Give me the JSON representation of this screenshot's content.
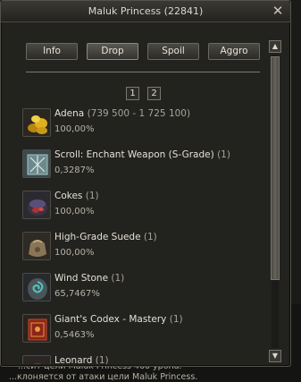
{
  "window": {
    "title": "Maluk Princess (22841)"
  },
  "tabs": [
    {
      "label": "Info"
    },
    {
      "label": "Drop"
    },
    {
      "label": "Spoil"
    },
    {
      "label": "Aggro"
    }
  ],
  "pages": [
    "1",
    "2"
  ],
  "items": [
    {
      "name": "Adena",
      "qty": "(739 500 - 1 725 100)",
      "chance": "100,00%",
      "icon": "adena-coins-icon"
    },
    {
      "name": "Scroll: Enchant Weapon (S-Grade)",
      "qty": "(1)",
      "chance": "0,3287%",
      "icon": "scroll-icon"
    },
    {
      "name": "Cokes",
      "qty": "(1)",
      "chance": "100,00%",
      "icon": "cokes-icon"
    },
    {
      "name": "High-Grade Suede",
      "qty": "(1)",
      "chance": "100,00%",
      "icon": "suede-bag-icon"
    },
    {
      "name": "Wind Stone",
      "qty": "(1)",
      "chance": "65,7467%",
      "icon": "wind-stone-icon"
    },
    {
      "name": "Giant's Codex - Mastery",
      "qty": "(1)",
      "chance": "0,5463%",
      "icon": "codex-book-icon"
    },
    {
      "name": "Leonard",
      "qty": "(1)",
      "chance": "",
      "icon": "leonard-icon"
    }
  ],
  "background_chat": [
    "е",
    "е",
    "...сит цели Maluk Princess 460 урона.",
    "...клоняется от атаки цели Maluk Princess."
  ]
}
